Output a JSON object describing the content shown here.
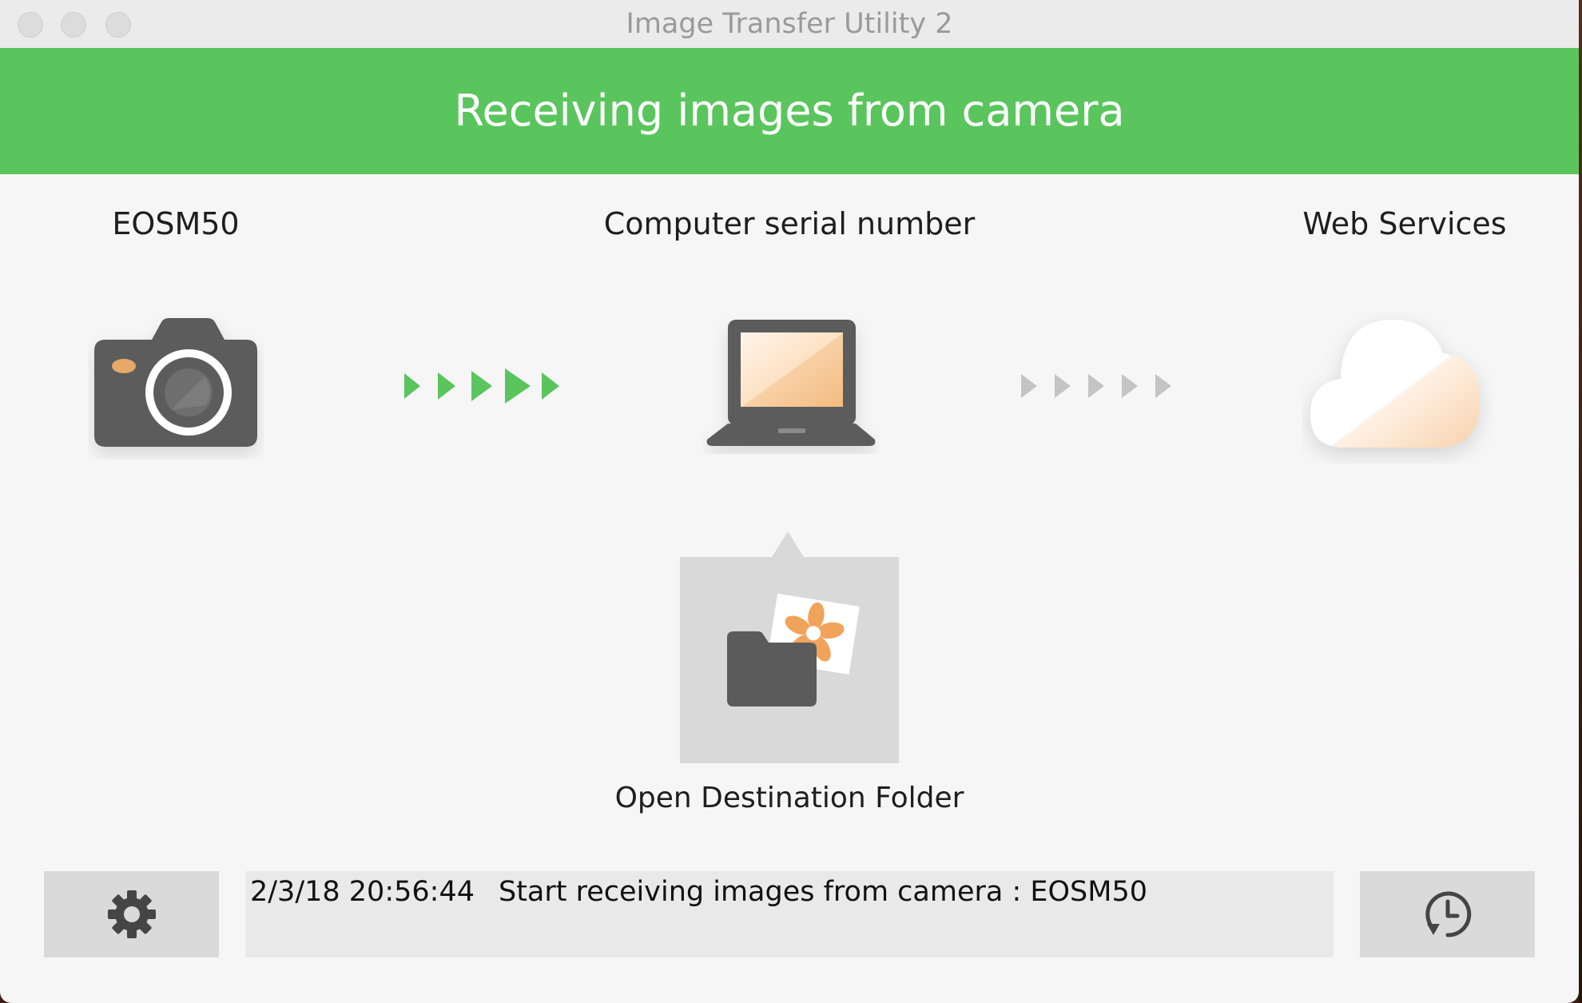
{
  "window": {
    "title": "Image Transfer Utility 2"
  },
  "banner": {
    "status_text": "Receiving images from camera",
    "color": "#5ac55d"
  },
  "devices": {
    "camera": {
      "label": "EOSM50",
      "icon": "camera-icon"
    },
    "computer": {
      "label": "Computer serial number",
      "icon": "laptop-icon"
    },
    "cloud": {
      "label": "Web Services",
      "icon": "cloud-icon"
    }
  },
  "transfer": {
    "camera_to_computer": {
      "state": "active",
      "color": "#5ac55d"
    },
    "computer_to_cloud": {
      "state": "inactive",
      "color": "#c4c4c4"
    }
  },
  "destination": {
    "button_label": "Open Destination Folder",
    "icon": "folder-photo-icon"
  },
  "log": {
    "entries": [
      {
        "time": "2/3/18 20:56:44",
        "message": "Start receiving images from camera : EOSM50"
      }
    ]
  },
  "toolbar": {
    "settings_icon": "gear-icon",
    "history_icon": "history-clock-icon"
  },
  "colors": {
    "accent_green": "#5ac55d",
    "icon_dark": "#5b5b5b",
    "screen_peach": "#f6c58f"
  }
}
